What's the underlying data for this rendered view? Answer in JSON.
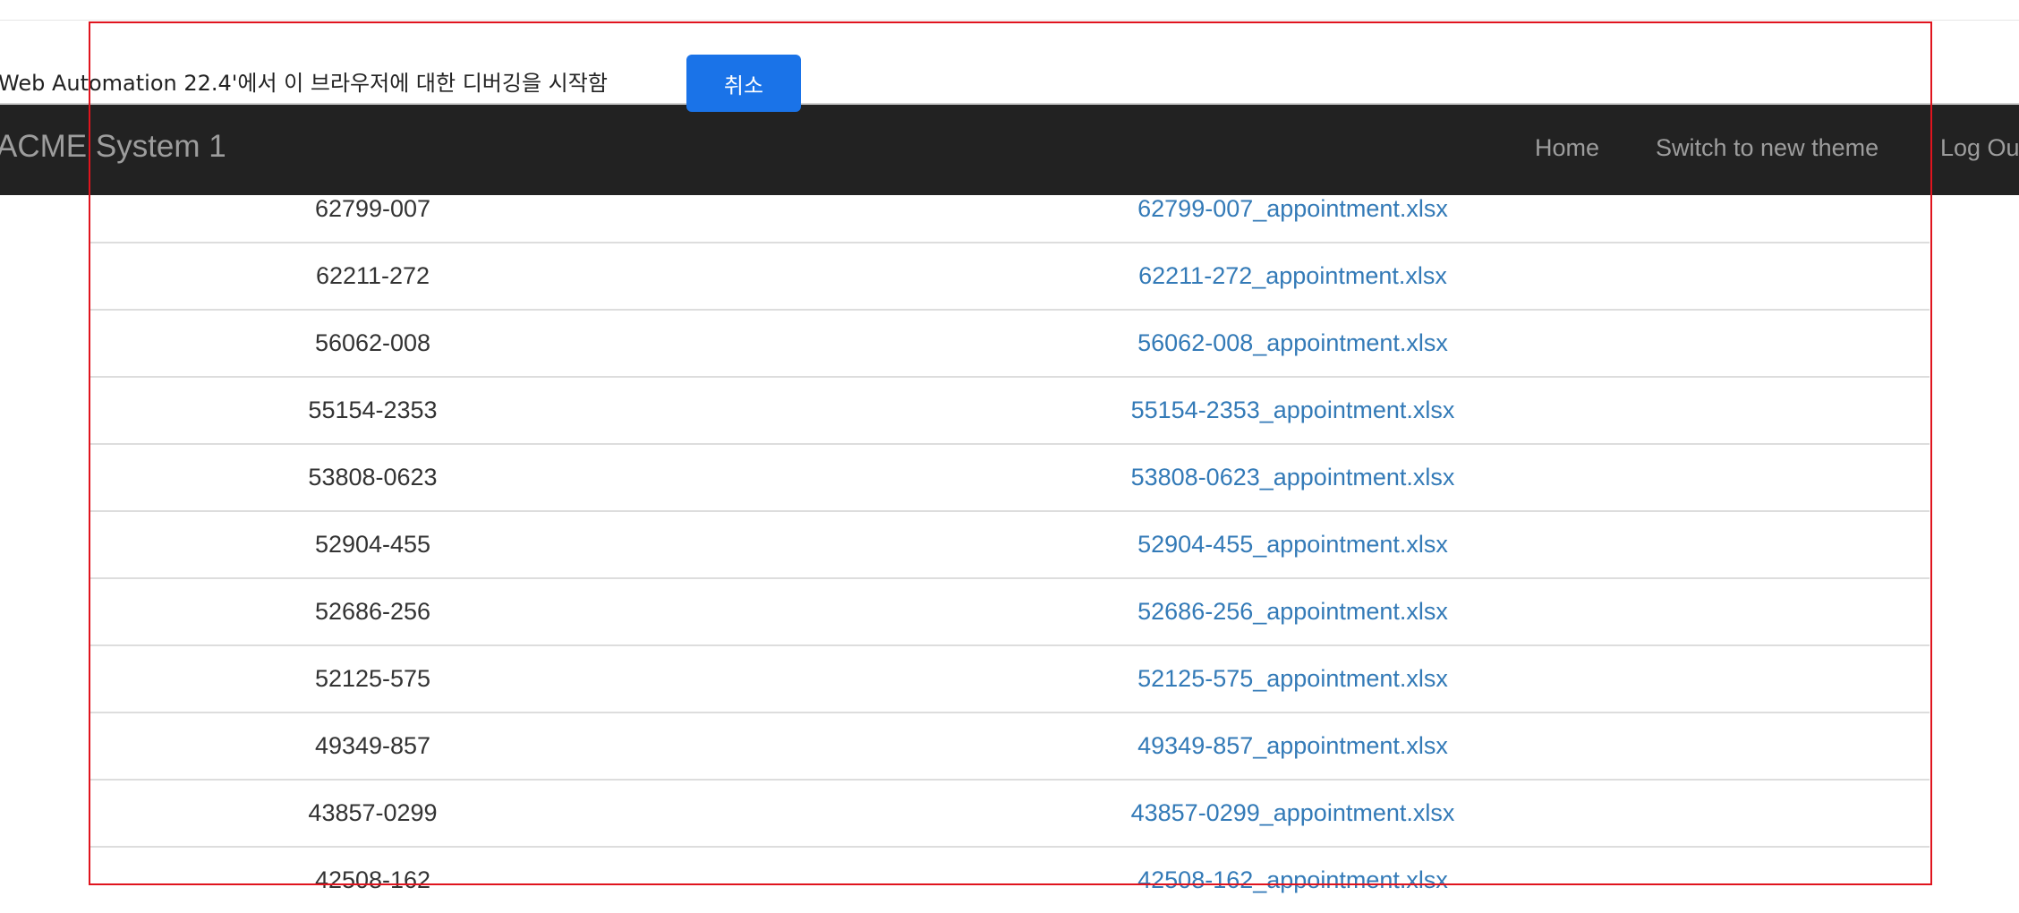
{
  "debug_bar": {
    "message": "Web Automation 22.4'에서 이 브라우저에 대한 디버깅을 시작함",
    "cancel_label": "취소"
  },
  "navbar": {
    "brand": "ACME System 1",
    "links": [
      "Home",
      "Switch to new theme",
      "Log Out"
    ]
  },
  "table": {
    "rows": [
      {
        "id": "62799-007",
        "file": "62799-007_appointment.xlsx"
      },
      {
        "id": "62211-272",
        "file": "62211-272_appointment.xlsx"
      },
      {
        "id": "56062-008",
        "file": "56062-008_appointment.xlsx"
      },
      {
        "id": "55154-2353",
        "file": "55154-2353_appointment.xlsx"
      },
      {
        "id": "53808-0623",
        "file": "53808-0623_appointment.xlsx"
      },
      {
        "id": "52904-455",
        "file": "52904-455_appointment.xlsx"
      },
      {
        "id": "52686-256",
        "file": "52686-256_appointment.xlsx"
      },
      {
        "id": "52125-575",
        "file": "52125-575_appointment.xlsx"
      },
      {
        "id": "49349-857",
        "file": "49349-857_appointment.xlsx"
      },
      {
        "id": "43857-0299",
        "file": "43857-0299_appointment.xlsx"
      },
      {
        "id": "42508-162",
        "file": "42508-162_appointment.xlsx"
      }
    ]
  },
  "colors": {
    "navbar_bg": "#222222",
    "link": "#337ab7",
    "cancel_button": "#1a73e8",
    "highlight_frame": "#e0141e"
  }
}
